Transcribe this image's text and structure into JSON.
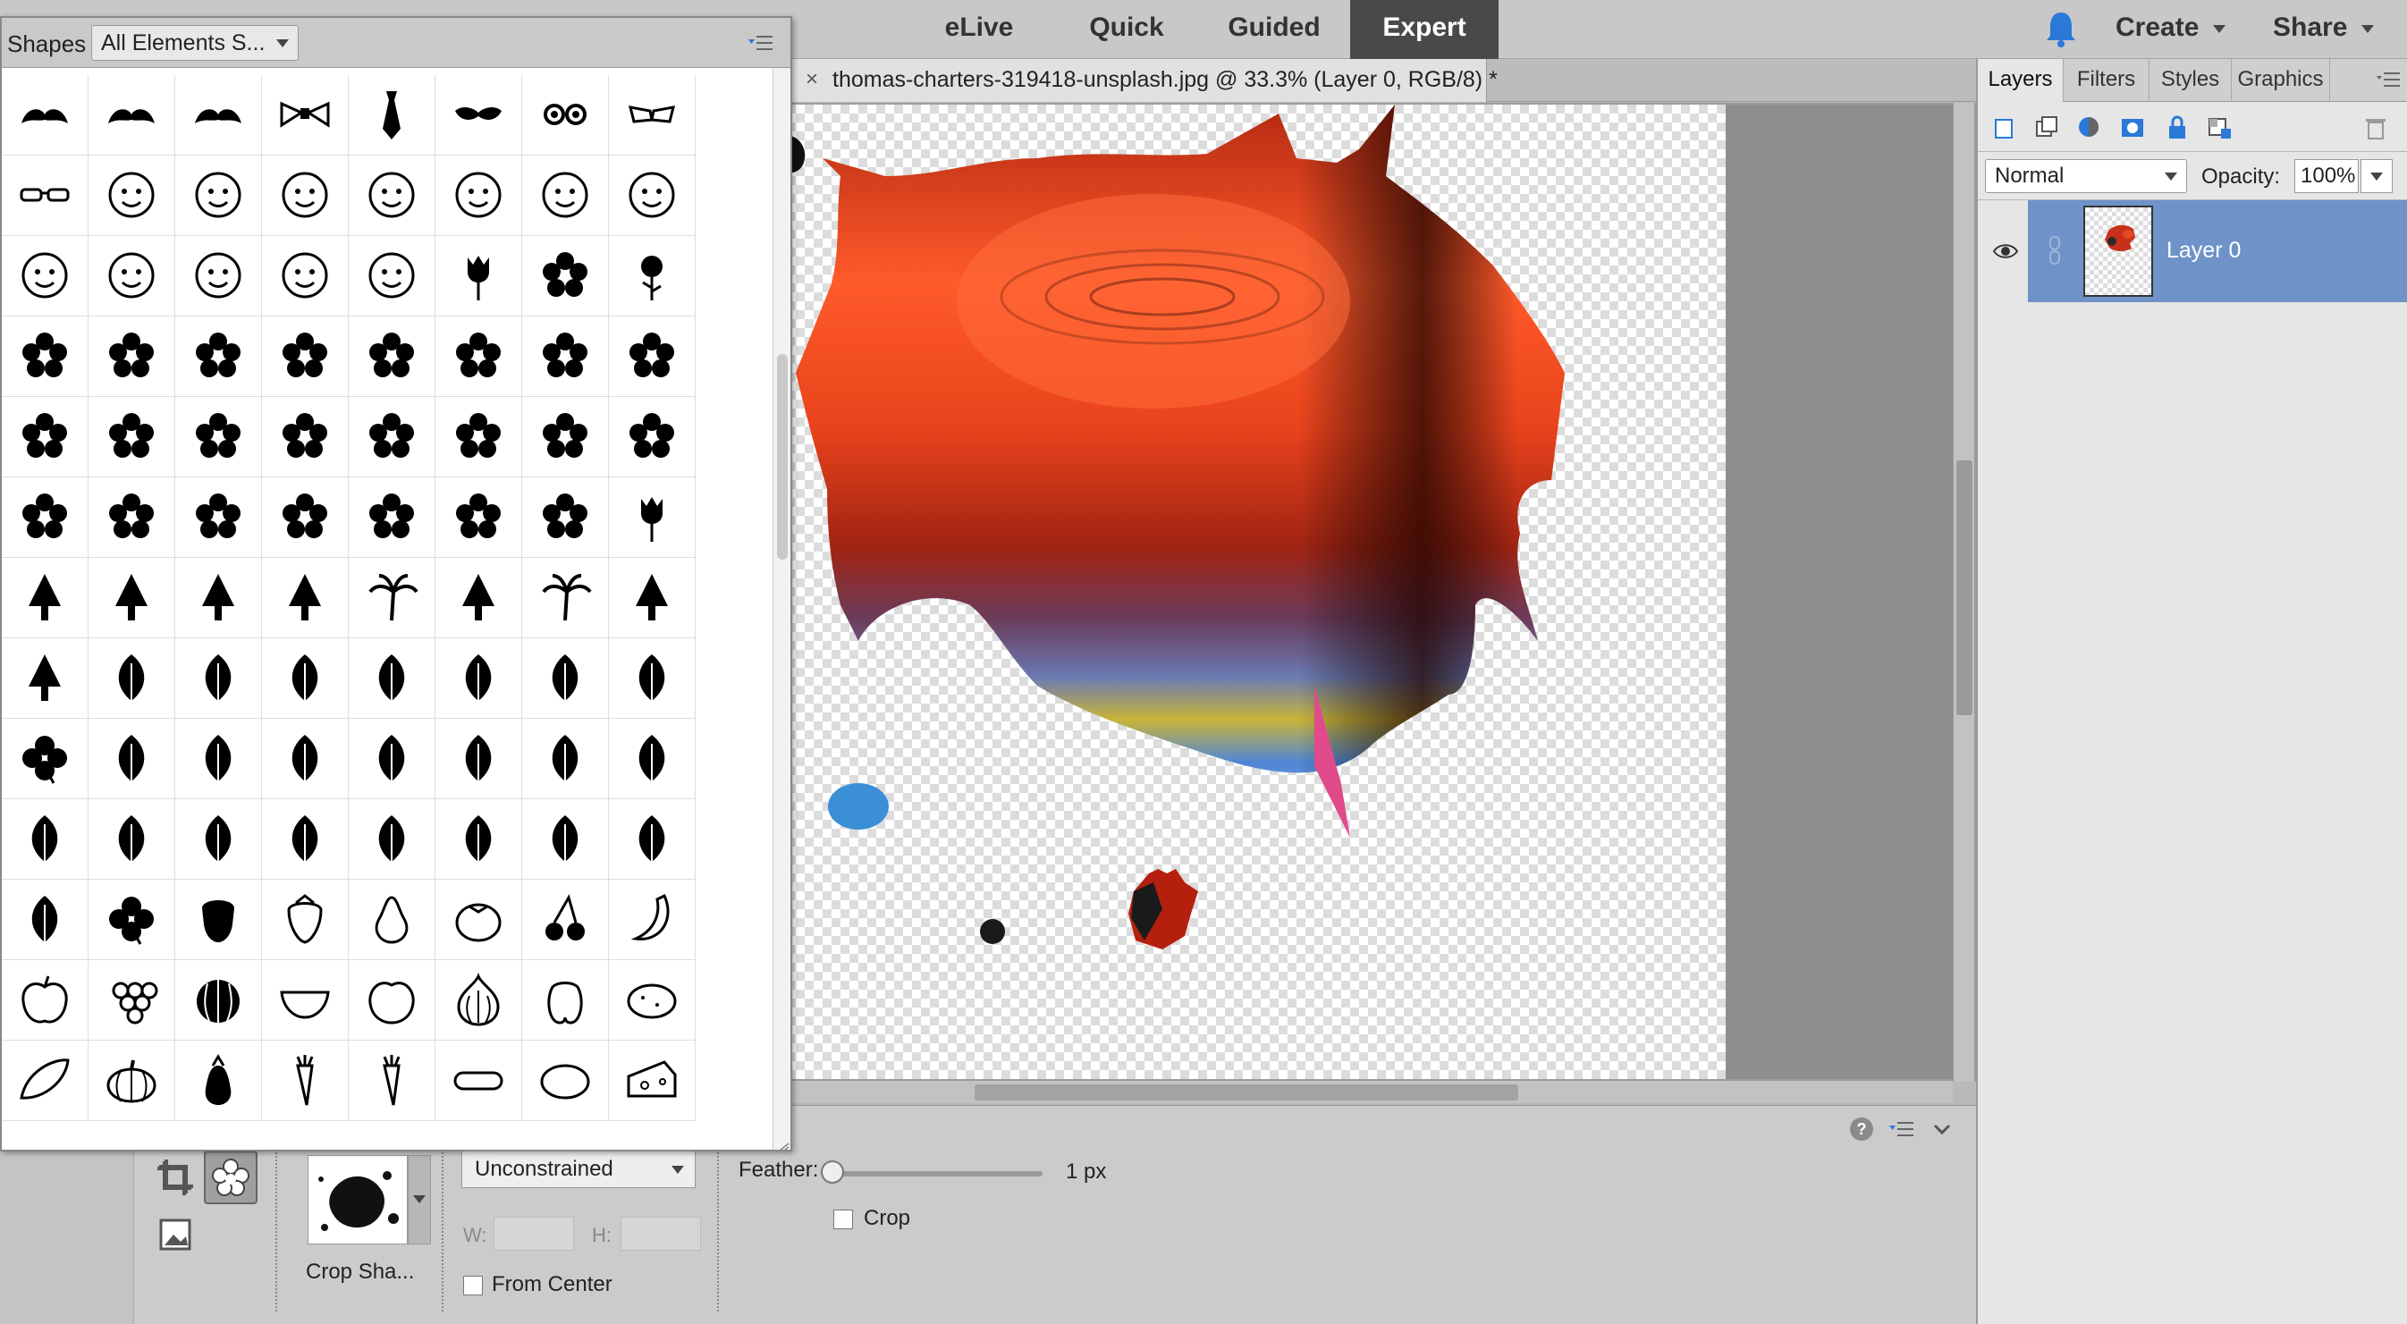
{
  "top_bar": {
    "modes": [
      {
        "label": "eLive",
        "active": false
      },
      {
        "label": "Quick",
        "active": false
      },
      {
        "label": "Guided",
        "active": false
      },
      {
        "label": "Expert",
        "active": true
      }
    ],
    "notification_icon": "bell-icon",
    "create_label": "Create",
    "share_label": "Share",
    "accent": "#2a79d8"
  },
  "document": {
    "close_glyph": "×",
    "title": "thomas-charters-319418-unsplash.jpg @ 33.3% (Layer 0, RGB/8) *"
  },
  "right_panel": {
    "tabs": [
      {
        "label": "Layers",
        "active": true
      },
      {
        "label": "Filters",
        "active": false
      },
      {
        "label": "Styles",
        "active": false
      },
      {
        "label": "Graphics",
        "active": false
      }
    ],
    "blend_mode": "Normal",
    "opacity_label": "Opacity:",
    "opacity_value": "100%",
    "layers": [
      {
        "name": "Layer 0",
        "visible": true,
        "selected": true
      }
    ],
    "selection_color": "#6f93c9"
  },
  "shapes_panel": {
    "title": "Shapes",
    "category": "All Elements S...",
    "icons": [
      "mustache",
      "mustache",
      "mustache",
      "bow-tie",
      "necktie",
      "eye-mask",
      "round-glasses",
      "eyebrow-glasses",
      "glasses",
      "face",
      "face",
      "face",
      "face",
      "face",
      "face",
      "face",
      "face",
      "face",
      "face",
      "face",
      "face",
      "tulip",
      "flower",
      "rose",
      "flower",
      "flower",
      "flower",
      "flower",
      "flower",
      "flower",
      "flower",
      "flower",
      "flower",
      "flower",
      "flower",
      "flower",
      "flower",
      "flower",
      "flower",
      "flower",
      "flower",
      "flower",
      "flower",
      "flower",
      "flower",
      "flower",
      "flower",
      "tulip",
      "tree",
      "tree",
      "tree",
      "tree",
      "palm-tree",
      "tree",
      "palm-tree",
      "tree",
      "tree",
      "leaf",
      "leaf",
      "leaf",
      "leaf",
      "leaf",
      "leaf",
      "leaf",
      "clover",
      "leaf",
      "leaf",
      "leaf",
      "leaf",
      "leaf",
      "leaf",
      "leaf",
      "leaf",
      "leaf",
      "leaf",
      "leaf",
      "leaf",
      "leaf",
      "leaf",
      "leaf",
      "leaf",
      "clover",
      "acorn",
      "strawberry",
      "pear",
      "tomato",
      "cherries",
      "banana",
      "apple",
      "grapes",
      "watermelon",
      "watermelon-slice",
      "peach",
      "garlic",
      "pepper",
      "potato",
      "sweet-potato",
      "pumpkin",
      "eggplant",
      "carrot",
      "carrot",
      "cucumber",
      "lemon",
      "cheese"
    ]
  },
  "tool_options": {
    "shape_label": "Crop Sha...",
    "ratio": "Unconstrained",
    "w_label": "W:",
    "h_label": "H:",
    "from_center_label": "From Center",
    "feather_label": "Feather:",
    "feather_value": "1 px",
    "feather_level": 0,
    "crop_label": "Crop",
    "from_center_checked": false,
    "crop_checked": false
  }
}
